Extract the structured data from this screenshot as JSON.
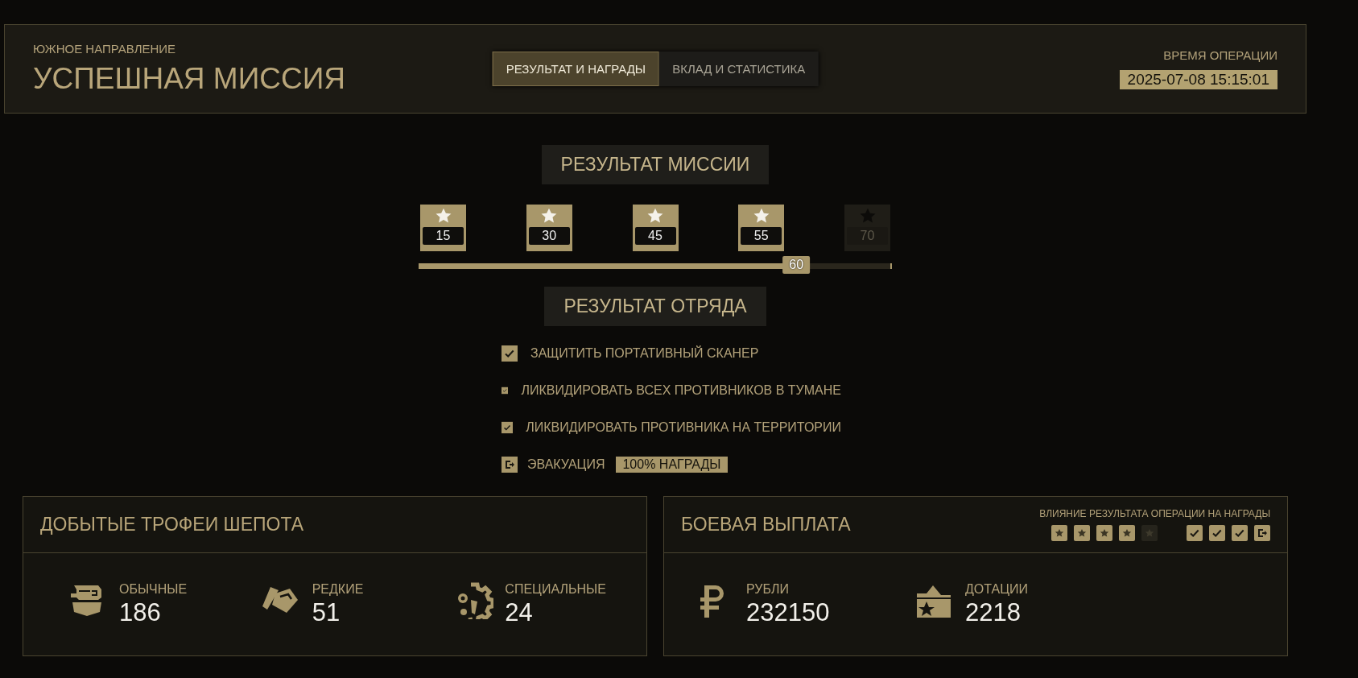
{
  "header": {
    "region": "ЮЖНОЕ НАПРАВЛЕНИЕ",
    "title": "УСПЕШНАЯ МИССИЯ",
    "tabs": [
      {
        "label": "РЕЗУЛЬТАТ И НАГРАДЫ",
        "selected": true
      },
      {
        "label": "ВКЛАД И СТАТИСТИКА",
        "selected": false
      }
    ],
    "time_label": "ВРЕМЯ ОПЕРАЦИИ",
    "time": "2025-07-08 15:15:01"
  },
  "mission": {
    "heading": "РЕЗУЛЬТАТ МИССИИ",
    "milestones": [
      {
        "value": "15",
        "achieved": true
      },
      {
        "value": "30",
        "achieved": true
      },
      {
        "value": "45",
        "achieved": true
      },
      {
        "value": "55",
        "achieved": true
      },
      {
        "value": "70",
        "achieved": false
      }
    ],
    "progress": {
      "level": 0.8,
      "reading": "60"
    }
  },
  "squad": {
    "heading": "РЕЗУЛЬТАТ ОТРЯДА",
    "tasks": [
      {
        "kind": "check",
        "label": "ЗАЩИТИТЬ ПОРТАТИВНЫЙ СКАНЕР",
        "checked": true
      },
      {
        "kind": "check",
        "label": "ЛИКВИДИРОВАТЬ ВСЕХ ПРОТИВНИКОВ В ТУМАНЕ",
        "checked": true
      },
      {
        "kind": "check",
        "label": "ЛИКВИДИРОВАТЬ ПРОТИВНИКА НА ТЕРРИТОРИИ",
        "checked": true
      },
      {
        "kind": "exit",
        "label": "ЭВАКУАЦИЯ",
        "badge": "100% НАГРАДЫ"
      }
    ]
  },
  "trophies": {
    "title": "ДОБЫТЫЕ ТРОФЕИ ШЕПОТА",
    "items": [
      {
        "kind": "common",
        "label": "ОБЫЧНЫЕ",
        "value": "186"
      },
      {
        "kind": "rare",
        "label": "РЕДКИЕ",
        "value": "51"
      },
      {
        "kind": "special",
        "label": "СПЕЦИАЛЬНЫЕ",
        "value": "24"
      }
    ]
  },
  "payout": {
    "title": "БОЕВАЯ ВЫПЛАТА",
    "influence_label": "ВЛИЯНИЕ РЕЗУЛЬТАТА ОПЕРАЦИИ НА НАГРАДЫ",
    "influence": [
      {
        "kind": "star",
        "on": true
      },
      {
        "kind": "star",
        "on": true
      },
      {
        "kind": "star",
        "on": true
      },
      {
        "kind": "star",
        "on": true
      },
      {
        "kind": "star",
        "on": false
      },
      {
        "kind": "check",
        "on": true
      },
      {
        "kind": "check",
        "on": true
      },
      {
        "kind": "check",
        "on": true
      },
      {
        "kind": "exit",
        "on": true
      }
    ],
    "items": [
      {
        "kind": "rubles",
        "label": "РУБЛИ",
        "value": "232150"
      },
      {
        "kind": "subsidy",
        "label": "ДОТАЦИИ",
        "value": "2218"
      }
    ]
  }
}
